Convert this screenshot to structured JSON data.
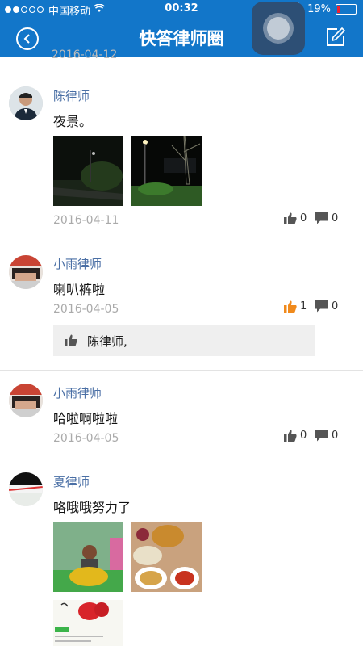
{
  "status_bar": {
    "carrier": "中国移动",
    "time": "00:32",
    "battery": "19%",
    "battery_level": 0.19
  },
  "header": {
    "title": "快答律师圈"
  },
  "posts": [
    {
      "name": "陈律师",
      "content": "夜景。",
      "date": "2016-04-11",
      "likes": "0",
      "comments": "0",
      "likes_highlighted": false
    },
    {
      "name": "小雨律师",
      "content": "喇叭裤啦",
      "date": "2016-04-05",
      "likes": "1",
      "comments": "0",
      "likes_highlighted": true,
      "liked_by": "陈律师,"
    },
    {
      "name": "小雨律师",
      "content": "哈啦啊啦啦",
      "date": "2016-04-05",
      "likes": "0",
      "comments": "0",
      "likes_highlighted": false
    },
    {
      "name": "夏律师",
      "content": "咯哦哦努力了"
    }
  ],
  "colors": {
    "header_bg": "#1276c9",
    "name": "#4a6fa5",
    "like_active": "#f08a1c"
  }
}
